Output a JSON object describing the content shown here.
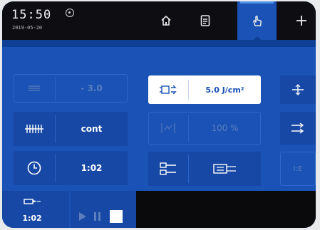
{
  "status": {
    "time": "15:50",
    "date": "2019-05-20"
  },
  "nav": {
    "items": [
      "home",
      "document",
      "hand",
      "add"
    ],
    "active": "hand"
  },
  "left_panel": {
    "row1": {
      "value": "- 3.0"
    },
    "row2": {
      "value": "cont"
    },
    "row3": {
      "value": "1:02"
    },
    "bottom": {
      "value": "1:02"
    }
  },
  "middle_panel": {
    "energy": {
      "value": "5.0 J/cm²"
    },
    "percent": {
      "value": "100 %"
    }
  },
  "right_panel": {
    "label_bottom": "I:E"
  },
  "colors": {
    "background": "#1a52b6",
    "topbar": "#0d0d12",
    "accent": "#4d8fe8",
    "text": "#ffffff",
    "dim_text": "#5b7fbf"
  }
}
